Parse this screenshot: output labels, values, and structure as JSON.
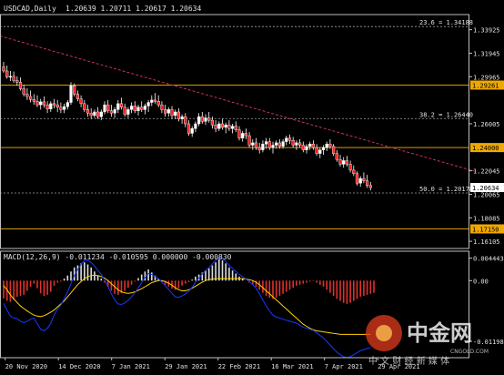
{
  "header": {
    "symbol": "USDCAD,Daily",
    "ohlc": "1.20639 1.20711 1.20617 1.20634"
  },
  "colors": {
    "background": "#000000",
    "axis": "#c0c0c0",
    "text": "#e0e0e0",
    "grid_dashed": "#a0a0a0",
    "bull_body": "#ffffff",
    "bear_body": "#ff2020",
    "wick": "#ffffff",
    "trendline": "#cc3355",
    "hline": "#d79b00",
    "price_tag": "#ffffff",
    "hline_tag": "#f0a800",
    "macd_hist": "#dcdcdc",
    "macd_hist_neg": "#e03030",
    "macd_signal": "#ffd200",
    "macd_line": "#1838ff"
  },
  "price_axis": {
    "labels": [
      "1.33925",
      "1.31945",
      "1.29965",
      "1.26005",
      "1.22045",
      "1.20065",
      "1.18085",
      "1.16105"
    ]
  },
  "levels": [
    {
      "label": "23.6 = 1.34188",
      "price": 1.34188,
      "kind": "fib"
    },
    {
      "label": "38.2 = 1.26440",
      "price": 1.2644,
      "kind": "fib"
    },
    {
      "label": "50.0 = 1.20178",
      "price": 1.20178,
      "kind": "fib"
    },
    {
      "label": "1.29261",
      "price": 1.29261,
      "kind": "hline"
    },
    {
      "label": "1.24000",
      "price": 1.24,
      "kind": "hline"
    },
    {
      "label": "1.17150",
      "price": 1.1715,
      "kind": "hline"
    }
  ],
  "last_price": "1.20634",
  "macd": {
    "title": "MACD(12,26,9) -0.011234 -0.010595 0.000000 -0.000830",
    "axis_labels": [
      "0.004443",
      "0.00",
      "-0.01198"
    ]
  },
  "x_labels": [
    "20 Nov 2020",
    "14 Dec 2020",
    "7 Jan 2021",
    "29 Jan 2021",
    "22 Feb 2021",
    "16 Mar 2021",
    "7 Apr 2021",
    "29 Apr 2021"
  ],
  "watermark": {
    "brand": "中金网",
    "sub": "中 文 财 经 新 媒 体",
    "url": "CNGOLD.COM"
  },
  "chart_data": {
    "type": "candlestick",
    "symbol": "USDCAD",
    "timeframe": "Daily",
    "ylim": [
      1.155,
      1.352
    ],
    "trendline": {
      "from": [
        0,
        1.334
      ],
      "to": [
        140,
        1.22
      ]
    },
    "candles": [
      [
        1.308,
        1.312,
        1.303,
        1.3045
      ],
      [
        1.3045,
        1.309,
        1.298,
        1.2995
      ],
      [
        1.2995,
        1.3045,
        1.296,
        1.3
      ],
      [
        1.3,
        1.304,
        1.2945,
        1.2965
      ],
      [
        1.2965,
        1.3,
        1.292,
        1.295
      ],
      [
        1.295,
        1.299,
        1.288,
        1.2895
      ],
      [
        1.2895,
        1.293,
        1.283,
        1.285
      ],
      [
        1.285,
        1.29,
        1.28,
        1.283
      ],
      [
        1.283,
        1.288,
        1.278,
        1.2805
      ],
      [
        1.2805,
        1.285,
        1.276,
        1.279
      ],
      [
        1.279,
        1.284,
        1.274,
        1.276
      ],
      [
        1.276,
        1.281,
        1.272,
        1.2785
      ],
      [
        1.2785,
        1.283,
        1.2735,
        1.276
      ],
      [
        1.276,
        1.279,
        1.269,
        1.2725
      ],
      [
        1.2725,
        1.279,
        1.27,
        1.277
      ],
      [
        1.277,
        1.281,
        1.273,
        1.276
      ],
      [
        1.276,
        1.28,
        1.27,
        1.274
      ],
      [
        1.274,
        1.278,
        1.269,
        1.272
      ],
      [
        1.272,
        1.277,
        1.269,
        1.2745
      ],
      [
        1.2745,
        1.28,
        1.272,
        1.278
      ],
      [
        1.278,
        1.295,
        1.276,
        1.292
      ],
      [
        1.292,
        1.294,
        1.283,
        1.285
      ],
      [
        1.285,
        1.288,
        1.279,
        1.281
      ],
      [
        1.281,
        1.284,
        1.274,
        1.277
      ],
      [
        1.277,
        1.28,
        1.27,
        1.272
      ],
      [
        1.272,
        1.276,
        1.266,
        1.269
      ],
      [
        1.269,
        1.273,
        1.264,
        1.267
      ],
      [
        1.267,
        1.272,
        1.265,
        1.27
      ],
      [
        1.27,
        1.274,
        1.264,
        1.266
      ],
      [
        1.266,
        1.272,
        1.263,
        1.27
      ],
      [
        1.27,
        1.279,
        1.268,
        1.276
      ],
      [
        1.276,
        1.28,
        1.269,
        1.271
      ],
      [
        1.271,
        1.276,
        1.266,
        1.269
      ],
      [
        1.269,
        1.274,
        1.265,
        1.272
      ],
      [
        1.272,
        1.28,
        1.269,
        1.277
      ],
      [
        1.277,
        1.282,
        1.272,
        1.274
      ],
      [
        1.274,
        1.277,
        1.266,
        1.268
      ],
      [
        1.268,
        1.274,
        1.265,
        1.272
      ],
      [
        1.272,
        1.278,
        1.269,
        1.275
      ],
      [
        1.275,
        1.279,
        1.269,
        1.271
      ],
      [
        1.271,
        1.276,
        1.267,
        1.274
      ],
      [
        1.274,
        1.279,
        1.27,
        1.272
      ],
      [
        1.272,
        1.277,
        1.268,
        1.275
      ],
      [
        1.275,
        1.28,
        1.27,
        1.278
      ],
      [
        1.278,
        1.284,
        1.275,
        1.28
      ],
      [
        1.28,
        1.286,
        1.277,
        1.279
      ],
      [
        1.279,
        1.284,
        1.274,
        1.276
      ],
      [
        1.276,
        1.279,
        1.269,
        1.272
      ],
      [
        1.272,
        1.276,
        1.266,
        1.269
      ],
      [
        1.269,
        1.274,
        1.266,
        1.272
      ],
      [
        1.272,
        1.275,
        1.264,
        1.267
      ],
      [
        1.267,
        1.272,
        1.264,
        1.27
      ],
      [
        1.27,
        1.273,
        1.262,
        1.264
      ],
      [
        1.264,
        1.268,
        1.26,
        1.266
      ],
      [
        1.266,
        1.269,
        1.257,
        1.26
      ],
      [
        1.26,
        1.263,
        1.25,
        1.252
      ],
      [
        1.252,
        1.258,
        1.249,
        1.256
      ],
      [
        1.256,
        1.262,
        1.253,
        1.26
      ],
      [
        1.26,
        1.269,
        1.258,
        1.266
      ],
      [
        1.266,
        1.27,
        1.26,
        1.262
      ],
      [
        1.262,
        1.268,
        1.259,
        1.265
      ],
      [
        1.265,
        1.27,
        1.261,
        1.263
      ],
      [
        1.263,
        1.266,
        1.256,
        1.259
      ],
      [
        1.259,
        1.263,
        1.253,
        1.256
      ],
      [
        1.256,
        1.262,
        1.254,
        1.26
      ],
      [
        1.26,
        1.264,
        1.255,
        1.257
      ],
      [
        1.257,
        1.261,
        1.252,
        1.259
      ],
      [
        1.259,
        1.263,
        1.254,
        1.256
      ],
      [
        1.256,
        1.26,
        1.252,
        1.258
      ],
      [
        1.258,
        1.262,
        1.253,
        1.255
      ],
      [
        1.255,
        1.258,
        1.246,
        1.248
      ],
      [
        1.248,
        1.254,
        1.245,
        1.252
      ],
      [
        1.252,
        1.256,
        1.247,
        1.25
      ],
      [
        1.25,
        1.253,
        1.24,
        1.242
      ],
      [
        1.242,
        1.247,
        1.238,
        1.244
      ],
      [
        1.244,
        1.248,
        1.238,
        1.24
      ],
      [
        1.24,
        1.244,
        1.235,
        1.238
      ],
      [
        1.238,
        1.246,
        1.236,
        1.243
      ],
      [
        1.243,
        1.248,
        1.239,
        1.245
      ],
      [
        1.245,
        1.248,
        1.238,
        1.24
      ],
      [
        1.24,
        1.245,
        1.235,
        1.242
      ],
      [
        1.242,
        1.246,
        1.239,
        1.244
      ],
      [
        1.244,
        1.247,
        1.239,
        1.241
      ],
      [
        1.241,
        1.247,
        1.239,
        1.245
      ],
      [
        1.245,
        1.25,
        1.242,
        1.248
      ],
      [
        1.248,
        1.251,
        1.243,
        1.246
      ],
      [
        1.246,
        1.249,
        1.24,
        1.242
      ],
      [
        1.242,
        1.246,
        1.238,
        1.244
      ],
      [
        1.244,
        1.247,
        1.24,
        1.242
      ],
      [
        1.242,
        1.245,
        1.236,
        1.238
      ],
      [
        1.238,
        1.243,
        1.235,
        1.241
      ],
      [
        1.241,
        1.245,
        1.238,
        1.243
      ],
      [
        1.243,
        1.246,
        1.238,
        1.24
      ],
      [
        1.24,
        1.243,
        1.233,
        1.235
      ],
      [
        1.235,
        1.24,
        1.231,
        1.238
      ],
      [
        1.238,
        1.242,
        1.234,
        1.24
      ],
      [
        1.24,
        1.245,
        1.237,
        1.243
      ],
      [
        1.243,
        1.247,
        1.239,
        1.241
      ],
      [
        1.241,
        1.243,
        1.233,
        1.235
      ],
      [
        1.235,
        1.238,
        1.228,
        1.23
      ],
      [
        1.23,
        1.234,
        1.224,
        1.226
      ],
      [
        1.226,
        1.232,
        1.223,
        1.229
      ],
      [
        1.229,
        1.233,
        1.224,
        1.226
      ],
      [
        1.226,
        1.229,
        1.219,
        1.221
      ],
      [
        1.221,
        1.225,
        1.216,
        1.218
      ],
      [
        1.218,
        1.22,
        1.208,
        1.21
      ],
      [
        1.21,
        1.216,
        1.207,
        1.214
      ],
      [
        1.214,
        1.219,
        1.21,
        1.212
      ],
      [
        1.212,
        1.217,
        1.206,
        1.208
      ],
      [
        1.208,
        1.211,
        1.204,
        1.2063
      ]
    ],
    "macd_hist": [
      -0.0035,
      -0.004,
      -0.0042,
      -0.0038,
      -0.0032,
      -0.003,
      -0.0028,
      -0.002,
      -0.0012,
      -0.0006,
      -0.0015,
      -0.0025,
      -0.003,
      -0.0028,
      -0.0022,
      -0.001,
      -0.0004,
      -0.0002,
      0.0004,
      0.001,
      0.0018,
      0.0026,
      0.003,
      0.0034,
      0.0036,
      0.0032,
      0.0026,
      0.0018,
      0.001,
      0.0004,
      -0.0004,
      -0.0012,
      -0.002,
      -0.0026,
      -0.0028,
      -0.0025,
      -0.002,
      -0.0014,
      -0.0008,
      -0.0002,
      0.0005,
      0.0012,
      0.0018,
      0.0022,
      0.0016,
      0.001,
      0.0004,
      -0.0003,
      -0.0008,
      -0.0012,
      -0.0016,
      -0.0018,
      -0.0015,
      -0.001,
      -0.0006,
      -0.0003,
      0.0002,
      0.0008,
      0.0012,
      0.0016,
      0.002,
      0.0024,
      0.003,
      0.0036,
      0.0042,
      0.004,
      0.0034,
      0.0026,
      0.002,
      0.0014,
      0.0008,
      0.0004,
      0.0,
      -0.0004,
      -0.0008,
      -0.0012,
      -0.0018,
      -0.0024,
      -0.003,
      -0.0034,
      -0.0036,
      -0.0034,
      -0.003,
      -0.0026,
      -0.0022,
      -0.0018,
      -0.0014,
      -0.001,
      -0.0008,
      -0.0006,
      -0.0004,
      -0.0002,
      -0.0001,
      -0.0004,
      -0.0008,
      -0.0012,
      -0.0018,
      -0.0024,
      -0.003,
      -0.0036,
      -0.004,
      -0.0044,
      -0.0046,
      -0.0044,
      -0.004,
      -0.0036,
      -0.0032,
      -0.003,
      -0.0028,
      -0.0026,
      -0.0024
    ],
    "macd_signal": [
      -0.001,
      -0.0018,
      -0.0028,
      -0.0036,
      -0.0043,
      -0.005,
      -0.0055,
      -0.006,
      -0.0064,
      -0.0068,
      -0.007,
      -0.0071,
      -0.0069,
      -0.0066,
      -0.0062,
      -0.0058,
      -0.0052,
      -0.0046,
      -0.004,
      -0.0032,
      -0.0024,
      -0.0016,
      -0.0008,
      -0.0002,
      0.0004,
      0.0008,
      0.001,
      0.0011,
      0.001,
      0.0008,
      0.0005,
      0.0,
      -0.0006,
      -0.0012,
      -0.0018,
      -0.0022,
      -0.0024,
      -0.0025,
      -0.0024,
      -0.0022,
      -0.0019,
      -0.0016,
      -0.0012,
      -0.0008,
      -0.0004,
      -0.0002,
      0.0,
      0.0,
      -0.0002,
      -0.0005,
      -0.0009,
      -0.0014,
      -0.0018,
      -0.002,
      -0.002,
      -0.0018,
      -0.0015,
      -0.0011,
      -0.0007,
      -0.0003,
      0.0,
      0.0002,
      0.0003,
      0.0004,
      0.0004,
      0.0004,
      0.0004,
      0.0004,
      0.0004,
      0.0004,
      0.0004,
      0.0004,
      0.0003,
      0.0002,
      0.0,
      -0.0003,
      -0.0008,
      -0.0014,
      -0.002,
      -0.0026,
      -0.0032,
      -0.0038,
      -0.0044,
      -0.005,
      -0.0056,
      -0.0062,
      -0.0068,
      -0.0074,
      -0.008,
      -0.0086,
      -0.009,
      -0.0094,
      -0.0097,
      -0.0099,
      -0.01,
      -0.0101,
      -0.0102,
      -0.0103,
      -0.0104,
      -0.0105,
      -0.0106,
      -0.0106,
      -0.0106,
      -0.0106,
      -0.0106,
      -0.0106,
      -0.0106,
      -0.0106,
      -0.0106,
      -0.0106
    ],
    "macd_main": [
      -0.0045,
      -0.0058,
      -0.007,
      -0.0074,
      -0.0075,
      -0.008,
      -0.0083,
      -0.008,
      -0.0076,
      -0.0074,
      -0.0085,
      -0.0096,
      -0.0099,
      -0.0094,
      -0.0084,
      -0.0068,
      -0.0056,
      -0.0048,
      -0.0036,
      -0.0022,
      -0.0006,
      0.001,
      0.0022,
      0.0032,
      0.004,
      0.004,
      0.0036,
      0.0029,
      0.002,
      0.0012,
      0.0001,
      -0.0012,
      -0.0026,
      -0.0038,
      -0.0046,
      -0.0047,
      -0.0044,
      -0.0039,
      -0.0032,
      -0.0024,
      -0.0014,
      -0.0004,
      0.0006,
      0.0014,
      0.0012,
      0.0008,
      0.0004,
      -0.0003,
      -0.001,
      -0.0017,
      -0.0025,
      -0.0032,
      -0.0033,
      -0.003,
      -0.0026,
      -0.0021,
      -0.0013,
      -0.0003,
      0.0005,
      0.0013,
      0.002,
      0.0026,
      0.0033,
      0.004,
      0.0046,
      0.0044,
      0.0038,
      0.003,
      0.0024,
      0.0018,
      0.0012,
      0.0008,
      0.0003,
      -0.0002,
      -0.0008,
      -0.0015,
      -0.0026,
      -0.0038,
      -0.005,
      -0.006,
      -0.0068,
      -0.0072,
      -0.0074,
      -0.0076,
      -0.0078,
      -0.008,
      -0.0082,
      -0.0084,
      -0.0088,
      -0.0092,
      -0.0094,
      -0.0096,
      -0.0098,
      -0.0103,
      -0.0108,
      -0.0113,
      -0.012,
      -0.0127,
      -0.0134,
      -0.0141,
      -0.0146,
      -0.015,
      -0.0152,
      -0.015,
      -0.0146,
      -0.0142,
      -0.0138,
      -0.0136,
      -0.0134,
      -0.0132
    ]
  }
}
